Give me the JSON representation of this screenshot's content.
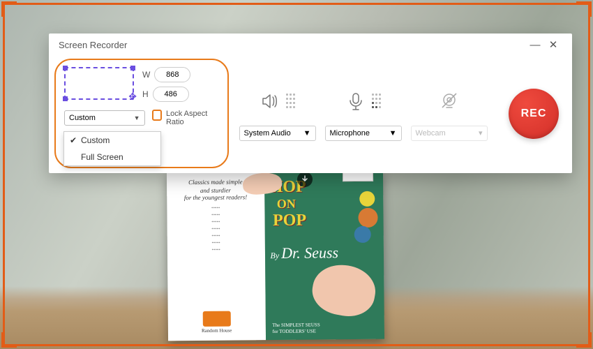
{
  "window": {
    "title": "Screen Recorder",
    "minimize": "—",
    "close": "✕"
  },
  "capture": {
    "width_label": "W",
    "height_label": "H",
    "width_value": "868",
    "height_value": "486",
    "mode_selected": "Custom",
    "mode_options": [
      "Custom",
      "Full Screen"
    ],
    "lock_label": "Lock Aspect Ratio"
  },
  "sources": {
    "audio": {
      "label": "System Audio",
      "enabled": true
    },
    "mic": {
      "label": "Microphone",
      "enabled": true
    },
    "cam": {
      "label": "Webcam",
      "enabled": false
    }
  },
  "record": {
    "label": "REC"
  },
  "background": {
    "book_left": {
      "headline1": "Classics made simple",
      "headline2": "and sturdier",
      "headline3": "for the youngest readers!",
      "publisher": "Random House"
    },
    "book_right": {
      "line1": "HOP",
      "line2": "ON",
      "line3": "POP",
      "byline_prefix": "By",
      "byline_author": "Dr. Seuss",
      "subtitle1": "The SIMPLEST SEUSS",
      "subtitle2": "for TODDLERS' USE"
    }
  }
}
